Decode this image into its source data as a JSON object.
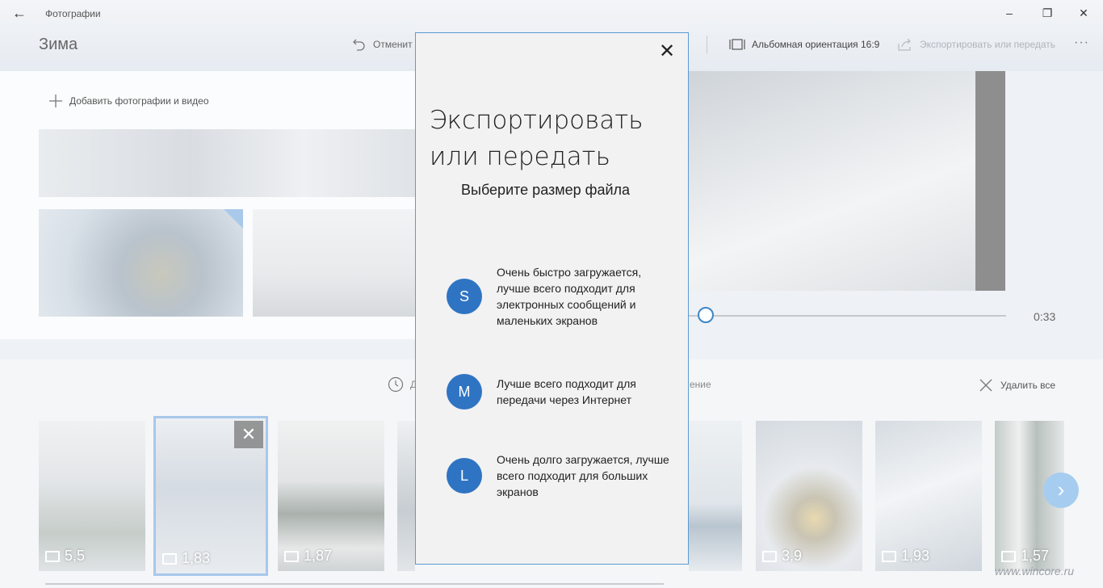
{
  "app": {
    "title": "Фотографии",
    "back_label": "←",
    "minimize": "–",
    "maximize": "❐",
    "close": "✕"
  },
  "toolbar": {
    "project_title": "Зима",
    "undo_label": "Отменит",
    "aspect_label": "Альбомная ориентация 16:9",
    "export_label": "Экспортировать или передать",
    "more_label": "···"
  },
  "media": {
    "add_label": "Добавить фотографии и видео"
  },
  "player": {
    "time": "0:33"
  },
  "storyboard": {
    "duration_partial": "Д",
    "text_partial": "ение",
    "delete_all_label": "Удалить все",
    "cards": [
      {
        "duration": "5,5"
      },
      {
        "duration": "1,83"
      },
      {
        "duration": "1,87"
      },
      {
        "duration": ""
      },
      {
        "duration": ""
      },
      {
        "duration": ""
      },
      {
        "duration": "3,9"
      },
      {
        "duration": "1,93"
      },
      {
        "duration": "1,57"
      }
    ],
    "remove_label": "✕",
    "next_label": "›"
  },
  "dialog": {
    "title": "Экспортировать или передать",
    "subtitle": "Выберите размер файла",
    "close_label": "✕",
    "options": [
      {
        "badge": "S",
        "desc": "Очень быстро загружается, лучше всего подходит для электронных сообщений и маленьких экранов"
      },
      {
        "badge": "M",
        "desc": "Лучше всего подходит для передачи через Интернет"
      },
      {
        "badge": "L",
        "desc": "Очень долго загружается, лучше всего подходит для больших экранов"
      }
    ]
  },
  "watermark": "www.wincore.ru",
  "colors": {
    "accent": "#2f74c3",
    "dialog_border": "#5b9bd5",
    "selected_card_border": "#a7c8ea"
  }
}
